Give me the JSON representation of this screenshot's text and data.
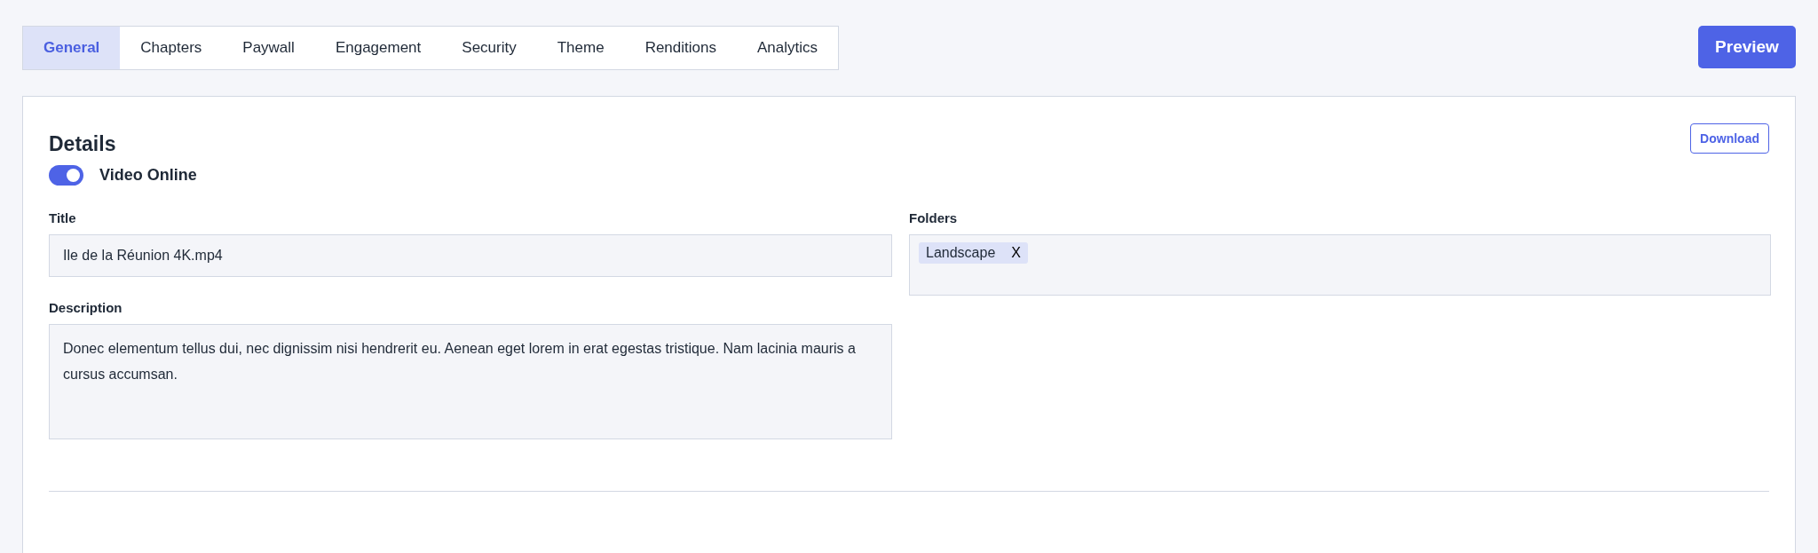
{
  "tabs": [
    {
      "label": "General",
      "selected": true
    },
    {
      "label": "Chapters",
      "selected": false
    },
    {
      "label": "Paywall",
      "selected": false
    },
    {
      "label": "Engagement",
      "selected": false
    },
    {
      "label": "Security",
      "selected": false
    },
    {
      "label": "Theme",
      "selected": false
    },
    {
      "label": "Renditions",
      "selected": false
    },
    {
      "label": "Analytics",
      "selected": false
    }
  ],
  "preview_button": "Preview",
  "details": {
    "heading": "Details",
    "download_button": "Download",
    "video_online": {
      "label": "Video Online",
      "on": true
    },
    "title": {
      "label": "Title",
      "value": "Ile de la Réunion 4K.mp4"
    },
    "folders": {
      "label": "Folders",
      "tags": [
        {
          "label": "Landscape",
          "remove": "X"
        }
      ]
    },
    "description": {
      "label": "Description",
      "value": "Donec elementum tellus dui, nec dignissim nisi hendrerit eu. Aenean eget lorem in erat egestas tristique. Nam lacinia mauris a cursus accumsan."
    }
  }
}
